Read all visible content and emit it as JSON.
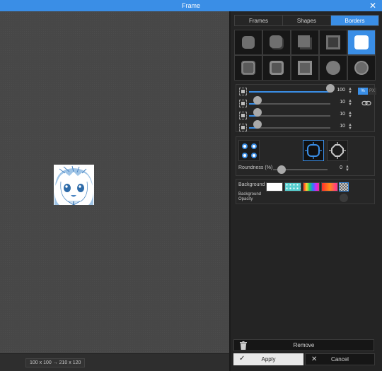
{
  "window": {
    "title": "Frame"
  },
  "canvas": {
    "dimensions": "100 x 100 → 210 x 120"
  },
  "tabs": [
    {
      "label": "Frames",
      "active": false
    },
    {
      "label": "Shapes",
      "active": false
    },
    {
      "label": "Borders",
      "active": true
    }
  ],
  "borders": {
    "selected_index": 4
  },
  "sliders": [
    {
      "name": "size",
      "value": "100",
      "level_pct": 100
    },
    {
      "name": "top",
      "value": "10",
      "level_pct": 10
    },
    {
      "name": "middle",
      "value": "10",
      "level_pct": 10
    },
    {
      "name": "bottom",
      "value": "10",
      "level_pct": 10
    }
  ],
  "units": {
    "percent": "%",
    "pixels": "PX"
  },
  "roundness": {
    "label": "Roundness (%)",
    "value": "0"
  },
  "background": {
    "label": "Background",
    "opacity_label": "Background Opacity"
  },
  "buttons": {
    "remove": "Remove",
    "apply": "Apply",
    "cancel": "Cancel"
  },
  "colors": {
    "accent": "#3a8ee6",
    "panel": "#242424",
    "canvas": "#474747"
  }
}
